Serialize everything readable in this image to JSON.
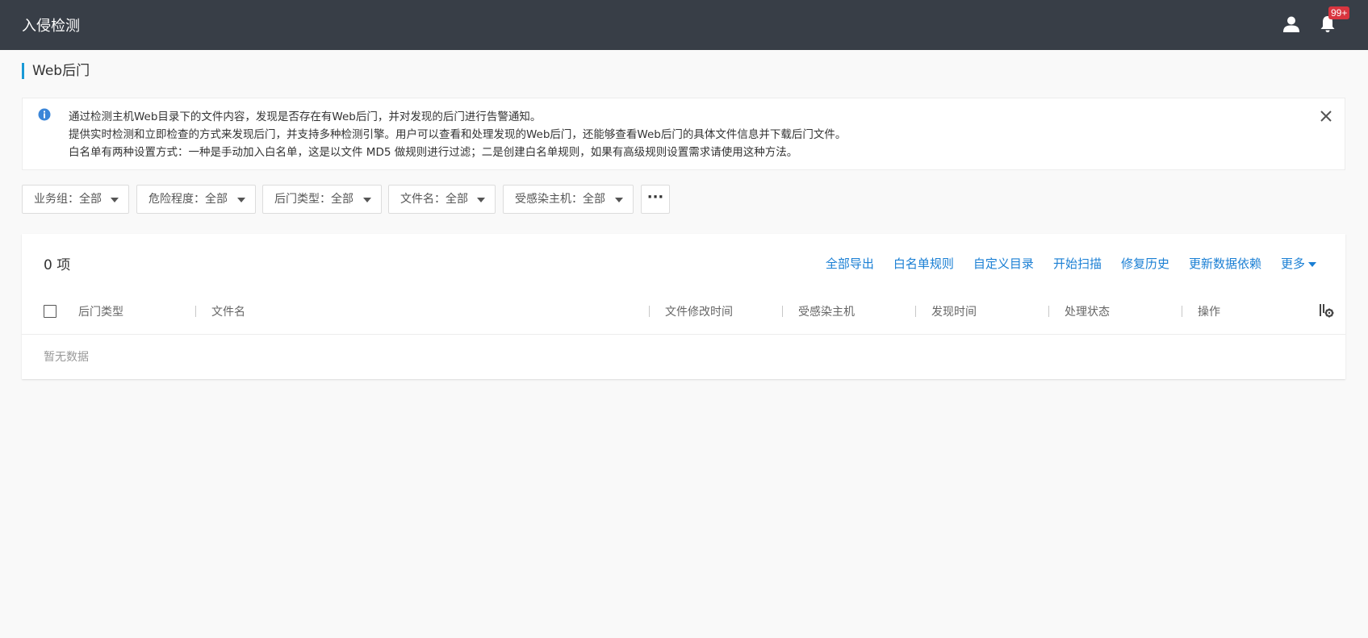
{
  "header": {
    "title": "入侵检测",
    "notification_badge": "99+"
  },
  "page": {
    "title": "Web后门"
  },
  "info": {
    "lines": [
      "通过检测主机Web目录下的文件内容，发现是否存在有Web后门，并对发现的后门进行告警通知。",
      "提供实时检测和立即检查的方式来发现后门，并支持多种检测引擎。用户可以查看和处理发现的Web后门，还能够查看Web后门的具体文件信息并下载后门文件。",
      "白名单有两种设置方式：一种是手动加入白名单，这是以文件 MD5 做规则进行过滤；二是创建白名单规则，如果有高级规则设置需求请使用这种方法。"
    ]
  },
  "filters": [
    {
      "label": "业务组：全部"
    },
    {
      "label": "危险程度：全部"
    },
    {
      "label": "后门类型：全部"
    },
    {
      "label": "文件名：全部"
    },
    {
      "label": "受感染主机：全部"
    }
  ],
  "more_filters_label": "···",
  "table": {
    "count_label": "0 项",
    "actions": [
      "全部导出",
      "白名单规则",
      "自定义目录",
      "开始扫描",
      "修复历史",
      "更新数据依赖"
    ],
    "more_label": "更多",
    "columns": [
      "后门类型",
      "文件名",
      "文件修改时间",
      "受感染主机",
      "发现时间",
      "处理状态",
      "操作"
    ],
    "empty_text": "暂无数据"
  },
  "colors": {
    "header_bg": "#383e47",
    "accent": "#1a9ad6",
    "link": "#1a7fd4",
    "badge": "#d9353f"
  }
}
